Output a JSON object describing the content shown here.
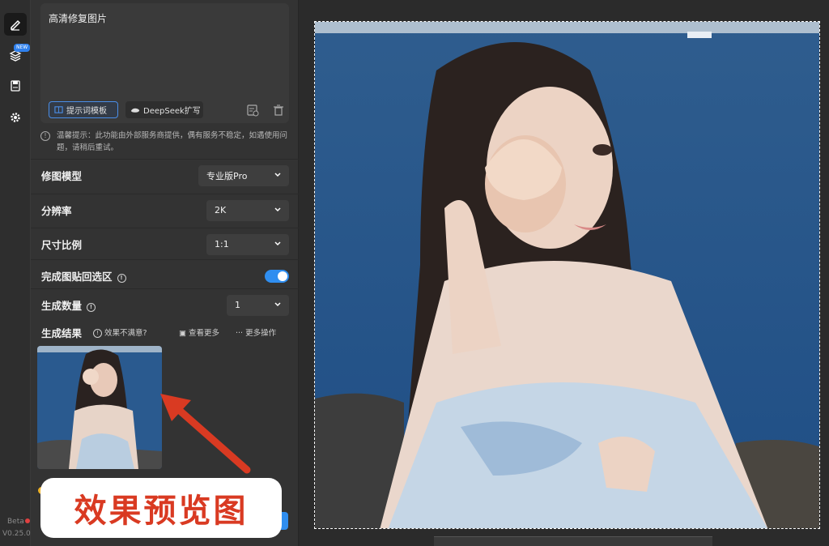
{
  "toolbar": {
    "new_badge": "NEW",
    "beta": "Beta",
    "version": "V0.25.0"
  },
  "prompt": {
    "text": "高清修复图片",
    "template_button": "提示词模板",
    "deepseek_button": "DeepSeek扩写"
  },
  "notice": "温馨提示：此功能由外部服务商提供，偶有服务不稳定，如遇使用问题，请稍后重试。",
  "settings": {
    "model": {
      "label": "修图模型",
      "value": "专业版Pro"
    },
    "resolution": {
      "label": "分辨率",
      "value": "2K"
    },
    "ratio": {
      "label": "尺寸比例",
      "value": "1:1"
    },
    "paste_back": {
      "label": "完成图贴回选区",
      "enabled": true
    },
    "count": {
      "label": "生成数量",
      "value": "1"
    }
  },
  "results": {
    "label": "生成结果",
    "unsatisfied": "效果不满意?",
    "view_more": "查看更多",
    "more_ops": "更多操作"
  },
  "annotation": "效果预览图",
  "colors": {
    "accent": "#2f8ef0",
    "annotation_red": "#d93a22"
  }
}
